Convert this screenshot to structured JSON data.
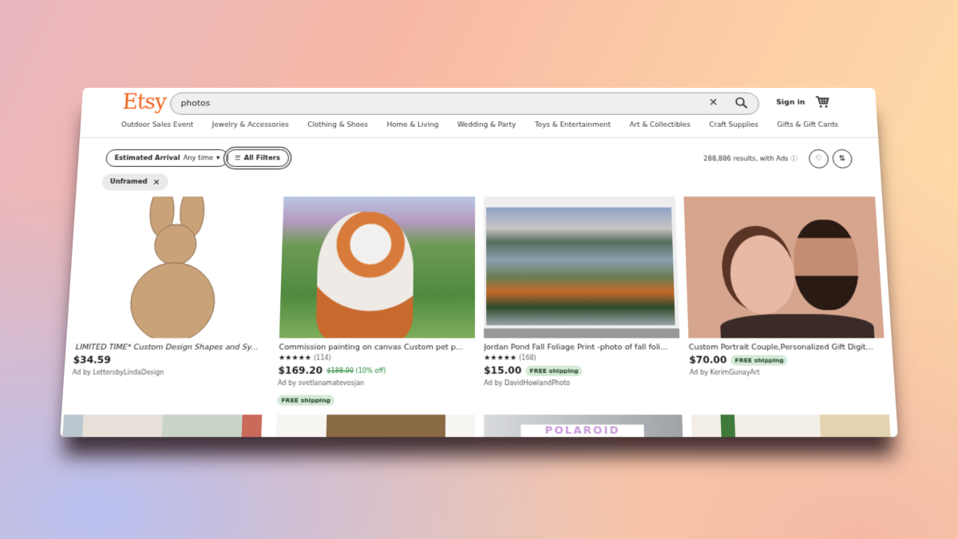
{
  "header": {
    "logo": "Etsy",
    "search_value": "photos",
    "sign_in": "Sign in"
  },
  "categories": [
    "Outdoor Sales Event",
    "Jewelry & Accessories",
    "Clothing & Shoes",
    "Home & Living",
    "Wedding & Party",
    "Toys & Entertainment",
    "Art & Collectibles",
    "Craft Supplies",
    "Gifts & Gift Cards"
  ],
  "filters": {
    "arrival_label": "Estimated Arrival",
    "arrival_value": "Any time",
    "all_filters": "All Filters",
    "active_chip": "Unframed",
    "results": "288,886 results, with Ads"
  },
  "colors": {
    "brand": "#F1641E",
    "sale": "#258635",
    "shipping_badge": "#D4E9D7"
  },
  "listings": [
    {
      "title": "LIMITED TIME* Custom Design Shapes and Sy...",
      "price": "$34.59",
      "seller": "Ad by LettersbyLindaDesign"
    },
    {
      "title": "Commission painting on canvas Custom pet p...",
      "rating": "★★★★★",
      "reviews": "(114)",
      "price": "$169.20",
      "original_price": "$188.00",
      "discount": "(10% off)",
      "seller": "Ad by svetlanamatevosjan",
      "shipping": "FREE shipping"
    },
    {
      "title": "Jordan Pond Fall Foliage Print -photo of fall foli...",
      "rating": "★★★★★",
      "reviews": "(168)",
      "price": "$15.00",
      "shipping": "FREE shipping",
      "seller": "Ad by DavidHowlandPhoto"
    },
    {
      "title": "Custom Portrait Couple,Personalized Gift Digit...",
      "price": "$70.00",
      "shipping": "FREE shipping",
      "seller": "Ad by KerimGunayArt"
    }
  ],
  "partial_row": {
    "polaroid_text": "POLAROID"
  }
}
